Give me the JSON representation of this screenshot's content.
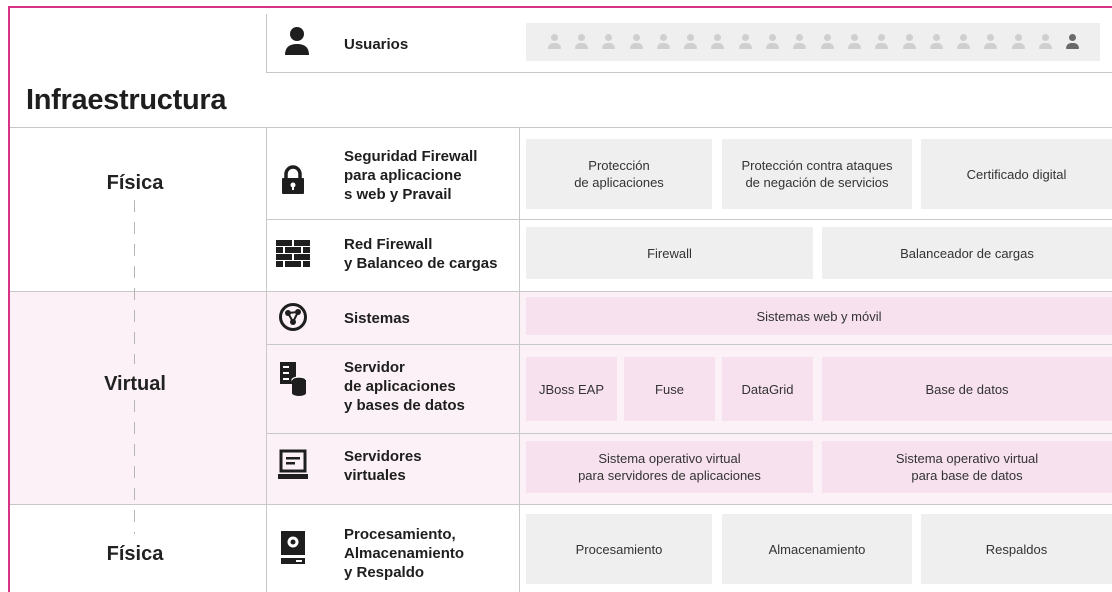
{
  "users": {
    "label": "Usuarios",
    "icons": 20
  },
  "title": "Infraestructura",
  "layers": {
    "fisica_top": "Física",
    "virtual": "Virtual",
    "fisica_bottom": "Física"
  },
  "rows": {
    "firewall_app": {
      "label": "Seguridad Firewall para aplicaciones web y Pravail",
      "icon": "lock-icon"
    },
    "red_firewall": {
      "label": "Red Firewall y Balanceo de cargas",
      "icon": "brick-wall-icon"
    },
    "sistemas": {
      "label": "Sistemas",
      "icon": "globe-network-icon"
    },
    "servidor_apps": {
      "label": "Servidor de aplicaciones y bases de datos",
      "icon": "server-database-icon"
    },
    "servidores_virtuales": {
      "label": "Servidores virtuales",
      "icon": "monitor-icon"
    },
    "procesamiento": {
      "label": "Procesamiento, Almacenamiento y Respaldo",
      "icon": "storage-drive-icon"
    }
  },
  "boxes": {
    "proteccion_apps": "Protección de aplicaciones",
    "proteccion_ataques": "Protección contra ataques de negación de servicios",
    "certificado": "Certificado digital",
    "firewall": "Firewall",
    "balanceador": "Balanceador de cargas",
    "sistemas_web": "Sistemas web y móvil",
    "jboss": "JBoss EAP",
    "fuse": "Fuse",
    "datagrid": "DataGrid",
    "base_datos": "Base de datos",
    "so_servidores": "Sistema operativo virtual para servidores de aplicaciones",
    "so_base_datos": "Sistema operativo virtual para base de datos",
    "procesamiento": "Procesamiento",
    "almacenamiento": "Almacenamiento",
    "respaldos": "Respaldos"
  },
  "colors": {
    "frame": "#d63384",
    "virtual_band": "#fcf1f6",
    "pink_box": "#f7e1ee",
    "gray_box": "#efefef"
  }
}
